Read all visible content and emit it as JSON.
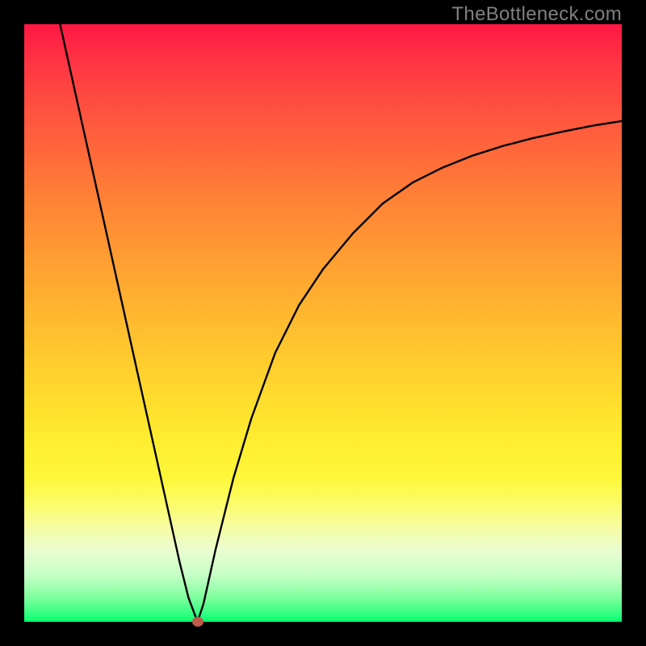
{
  "watermark": "TheBottleneck.com",
  "chart_data": {
    "type": "line",
    "title": "",
    "xlabel": "",
    "ylabel": "",
    "xlim": [
      0,
      100
    ],
    "ylim": [
      0,
      100
    ],
    "grid": false,
    "axes_shown": false,
    "background_gradient": {
      "top": "#ff1744",
      "middle": "#ffd400",
      "bottom": "#00ff6a"
    },
    "series": [
      {
        "name": "left-branch",
        "x": [
          6,
          8,
          10,
          12,
          14,
          16,
          18,
          20,
          22,
          24,
          26,
          27.5,
          29
        ],
        "y": [
          100,
          91,
          82,
          73,
          64,
          55,
          46,
          37,
          28,
          19,
          10,
          4,
          0
        ]
      },
      {
        "name": "right-branch",
        "x": [
          29,
          30,
          32,
          35,
          38,
          42,
          46,
          50,
          55,
          60,
          65,
          70,
          75,
          80,
          85,
          90,
          95,
          100
        ],
        "y": [
          0,
          3,
          12,
          24,
          34,
          45,
          53,
          59,
          65,
          70,
          73.5,
          76,
          78,
          79.6,
          80.9,
          82,
          83,
          83.8
        ]
      }
    ],
    "marker": {
      "x": 29,
      "y": 0,
      "color": "#c05a4a"
    }
  }
}
